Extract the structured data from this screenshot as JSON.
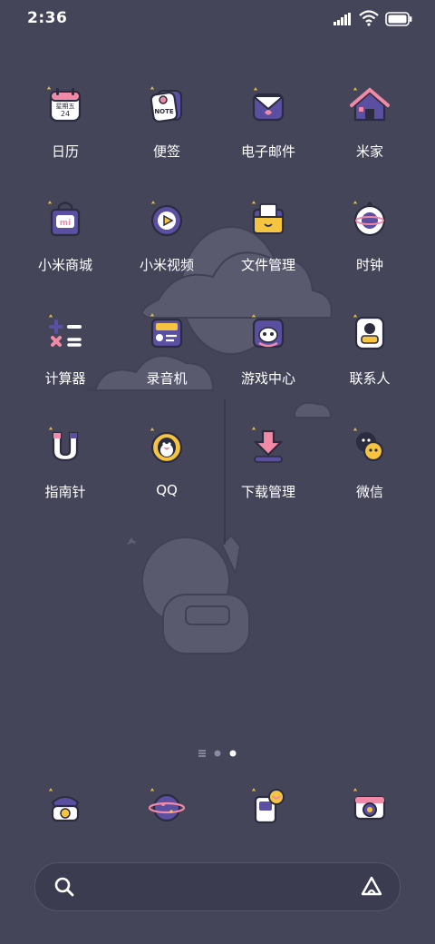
{
  "status_bar": {
    "time": "2:36"
  },
  "apps": [
    {
      "label": "日历",
      "icon": "calendar-icon",
      "calendar_text": "星期五",
      "calendar_day": "24"
    },
    {
      "label": "便签",
      "icon": "notes-icon",
      "note_text": "NOTE"
    },
    {
      "label": "电子邮件",
      "icon": "email-icon"
    },
    {
      "label": "米家",
      "icon": "home-icon"
    },
    {
      "label": "小米商城",
      "icon": "shopping-bag-icon",
      "bag_text": "mi"
    },
    {
      "label": "小米视频",
      "icon": "video-icon"
    },
    {
      "label": "文件管理",
      "icon": "folder-icon"
    },
    {
      "label": "时钟",
      "icon": "clock-icon"
    },
    {
      "label": "计算器",
      "icon": "calculator-icon"
    },
    {
      "label": "录音机",
      "icon": "recorder-icon"
    },
    {
      "label": "游戏中心",
      "icon": "game-center-icon"
    },
    {
      "label": "联系人",
      "icon": "contacts-icon"
    },
    {
      "label": "指南针",
      "icon": "compass-icon"
    },
    {
      "label": "QQ",
      "icon": "qq-penguin-icon"
    },
    {
      "label": "下载管理",
      "icon": "download-icon"
    },
    {
      "label": "微信",
      "icon": "wechat-icon"
    }
  ],
  "dock": [
    {
      "icon": "phone-icon"
    },
    {
      "icon": "browser-planet-icon"
    },
    {
      "icon": "messages-icon"
    },
    {
      "icon": "camera-icon"
    }
  ],
  "pager": {
    "pages": 3,
    "current": 3
  },
  "search_bar": {
    "left_icon": "search-icon",
    "right_icon": "assistant-icon"
  },
  "colors": {
    "background": "#444559",
    "icon_outline": "#2c2c40",
    "accent_yellow": "#f5c542",
    "accent_pink": "#f18aa6",
    "accent_purple": "#5a4fa0"
  }
}
